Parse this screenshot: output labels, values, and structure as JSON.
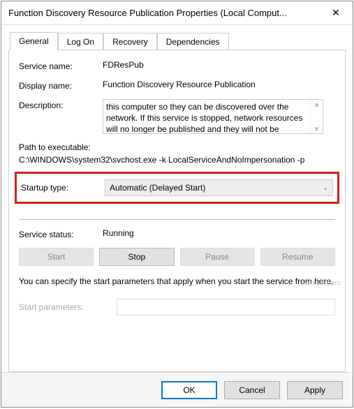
{
  "window": {
    "title": "Function Discovery Resource Publication Properties (Local Comput..."
  },
  "tabs": {
    "general": "General",
    "logon": "Log On",
    "recovery": "Recovery",
    "dependencies": "Dependencies"
  },
  "labels": {
    "service_name": "Service name:",
    "display_name": "Display name:",
    "description": "Description:",
    "path_label": "Path to executable:",
    "startup_type": "Startup type:",
    "service_status": "Service status:",
    "start_params": "Start parameters:"
  },
  "values": {
    "service_name": "FDResPub",
    "display_name": "Function Discovery Resource Publication",
    "description": "this computer so they can be discovered over the network.  If this service is stopped, network resources will no longer be published and they will not be",
    "path": "C:\\WINDOWS\\system32\\svchost.exe -k LocalServiceAndNoImpersonation -p",
    "startup_type": "Automatic (Delayed Start)",
    "service_status": "Running",
    "note": "You can specify the start parameters that apply when you start the service from here."
  },
  "buttons": {
    "start": "Start",
    "stop": "Stop",
    "pause": "Pause",
    "resume": "Resume",
    "ok": "OK",
    "cancel": "Cancel",
    "apply": "Apply"
  },
  "watermark": "wsxdn.com"
}
